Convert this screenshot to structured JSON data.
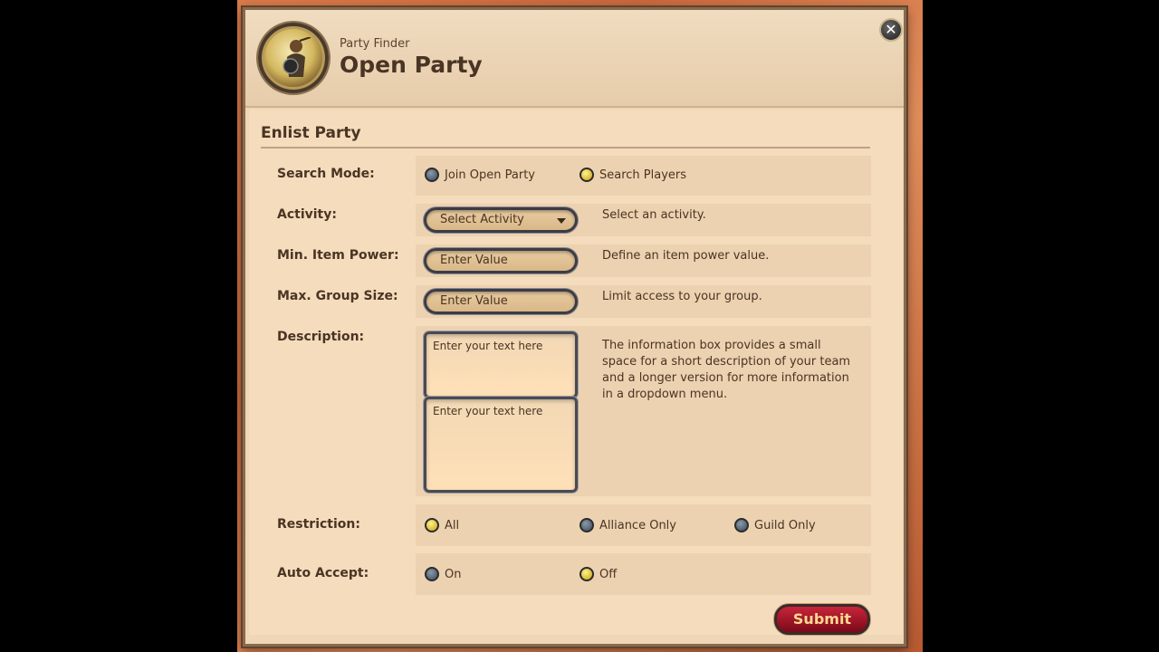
{
  "header": {
    "subtitle": "Party Finder",
    "title": "Open Party",
    "emblem_icon": "party-emblem-icon",
    "close_icon": "close-icon"
  },
  "section": {
    "title": "Enlist Party"
  },
  "search_mode": {
    "label": "Search Mode:",
    "options": [
      {
        "label": "Join Open Party",
        "selected": false
      },
      {
        "label": "Search Players",
        "selected": true
      }
    ]
  },
  "activity": {
    "label": "Activity:",
    "value": "Select Activity",
    "help": "Select an activity."
  },
  "min_item_power": {
    "label": "Min. Item Power:",
    "placeholder": "Enter Value",
    "help": "Define an item power value."
  },
  "max_group_size": {
    "label": "Max. Group Size:",
    "placeholder": "Enter Value",
    "help": "Limit access to your group."
  },
  "description": {
    "label": "Description:",
    "short_placeholder": "Enter your text here",
    "long_placeholder": "Enter your text here",
    "help": "The information box provides a small space for a short description of your team and a longer version for more information in a dropdown menu."
  },
  "restriction": {
    "label": "Restriction:",
    "options": [
      {
        "label": "All",
        "selected": true
      },
      {
        "label": "Alliance Only",
        "selected": false
      },
      {
        "label": "Guild Only",
        "selected": false
      }
    ]
  },
  "auto_accept": {
    "label": "Auto Accept:",
    "options": [
      {
        "label": "On",
        "selected": false
      },
      {
        "label": "Off",
        "selected": true
      }
    ]
  },
  "submit_label": "Submit",
  "colors": {
    "panel": "#efd6b6",
    "text": "#4a3424",
    "radio_on": "#e8c820",
    "submit": "#a81428"
  }
}
